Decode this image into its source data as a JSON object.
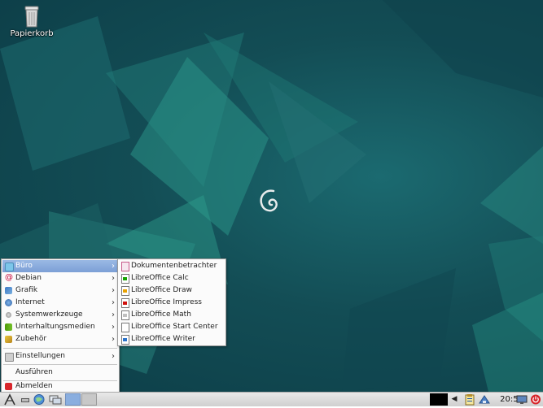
{
  "desktop": {
    "icons": [
      {
        "label": "Papierkorb",
        "icon": "trash-icon"
      }
    ]
  },
  "main_menu": {
    "items": [
      {
        "label": "Büro",
        "icon": "office-icon",
        "submenu": true,
        "selected": true
      },
      {
        "label": "Debian",
        "icon": "debian-icon",
        "submenu": true
      },
      {
        "label": "Grafik",
        "icon": "graphics-icon",
        "submenu": true
      },
      {
        "label": "Internet",
        "icon": "internet-icon",
        "submenu": true
      },
      {
        "label": "Systemwerkzeuge",
        "icon": "system-tools-icon",
        "submenu": true
      },
      {
        "label": "Unterhaltungsmedien",
        "icon": "multimedia-icon",
        "submenu": true
      },
      {
        "label": "Zubehör",
        "icon": "accessories-icon",
        "submenu": true
      },
      {
        "label": "Einstellungen",
        "icon": "settings-icon",
        "submenu": true
      },
      {
        "label": "Ausführen"
      },
      {
        "label": "Abmelden",
        "icon": "logout-icon"
      }
    ]
  },
  "submenu": {
    "items": [
      {
        "label": "Dokumentenbetrachter",
        "icon": "document-viewer-icon"
      },
      {
        "label": "LibreOffice Calc",
        "icon": "libreoffice-calc-icon"
      },
      {
        "label": "LibreOffice Draw",
        "icon": "libreoffice-draw-icon"
      },
      {
        "label": "LibreOffice Impress",
        "icon": "libreoffice-impress-icon"
      },
      {
        "label": "LibreOffice Math",
        "icon": "libreoffice-math-icon"
      },
      {
        "label": "LibreOffice Start Center",
        "icon": "libreoffice-start-icon"
      },
      {
        "label": "LibreOffice Writer",
        "icon": "libreoffice-writer-icon"
      }
    ]
  },
  "panel": {
    "clock": "20:56",
    "launchers": [
      "start-menu-icon",
      "show-desktop-icon",
      "web-browser-icon",
      "desktop-switcher-icon"
    ],
    "tray": [
      "arrow-left-icon",
      "clipboard-icon",
      "network-icon",
      "monitor-icon",
      "shutdown-icon"
    ]
  },
  "colors": {
    "menu_highlight": "#8aaedf",
    "desktop_bg": "#134d55",
    "panel_bg": "#dcdcdc"
  }
}
